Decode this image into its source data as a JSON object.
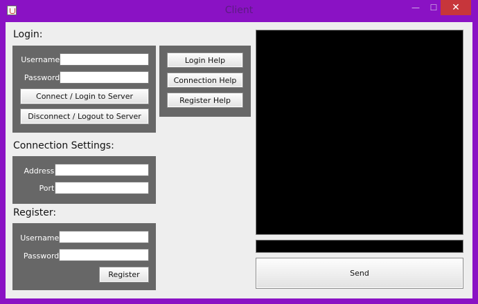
{
  "window": {
    "title": "Client",
    "minimize": "—",
    "maximize": "☐",
    "close": "✕"
  },
  "login": {
    "heading": "Login:",
    "username_label": "Username:",
    "password_label": "Password:",
    "username_value": "",
    "password_value": "",
    "connect_button": "Connect / Login to Server",
    "disconnect_button": "Disconnect / Logout to Server"
  },
  "help": {
    "login_help": "Login Help",
    "connection_help": "Connection Help",
    "register_help": "Register Help"
  },
  "connection": {
    "heading": "Connection Settings:",
    "address_label": "Address:",
    "port_label": "Port:",
    "address_value": "",
    "port_value": ""
  },
  "register": {
    "heading": "Register:",
    "username_label": "Username:",
    "password_label": "Password:",
    "username_value": "",
    "password_value": "",
    "register_button": "Register"
  },
  "chat": {
    "message_value": "",
    "send_button": "Send"
  },
  "colors": {
    "frame": "#8a12c4",
    "close_button": "#c7363b",
    "panel": "#676767",
    "display": "#000000"
  }
}
